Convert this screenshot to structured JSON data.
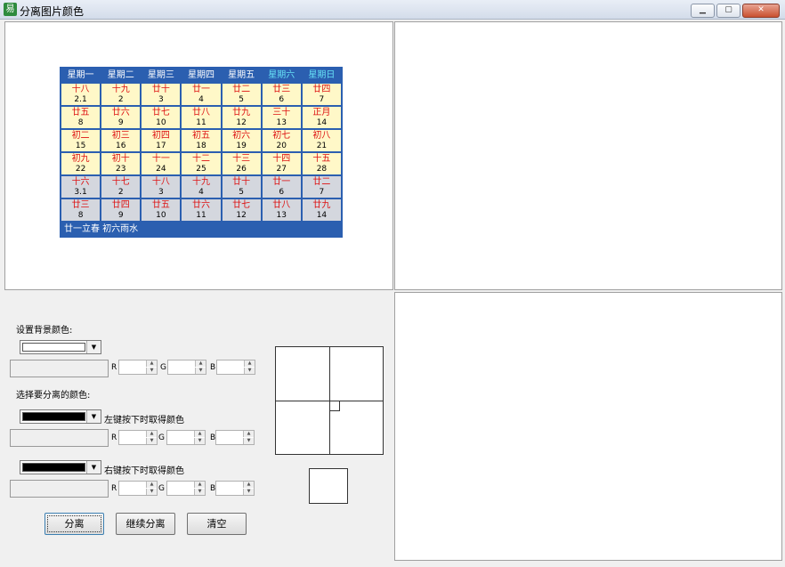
{
  "window": {
    "title": "分离图片颜色",
    "controls": [
      "minimize",
      "maximize",
      "close"
    ]
  },
  "calendar": {
    "weekdays": [
      "星期一",
      "星期二",
      "星期三",
      "星期四",
      "星期五",
      "星期六",
      "星期日"
    ],
    "rows": [
      {
        "gray": false,
        "cells": [
          [
            "十八",
            "2.1"
          ],
          [
            "十九",
            "2"
          ],
          [
            "廿十",
            "3"
          ],
          [
            "廿一",
            "4"
          ],
          [
            "廿二",
            "5"
          ],
          [
            "廿三",
            "6"
          ],
          [
            "廿四",
            "7"
          ]
        ]
      },
      {
        "gray": false,
        "cells": [
          [
            "廿五",
            "8"
          ],
          [
            "廿六",
            "9"
          ],
          [
            "廿七",
            "10"
          ],
          [
            "廿八",
            "11"
          ],
          [
            "廿九",
            "12"
          ],
          [
            "三十",
            "13"
          ],
          [
            "正月",
            "14"
          ]
        ]
      },
      {
        "gray": false,
        "cells": [
          [
            "初二",
            "15"
          ],
          [
            "初三",
            "16"
          ],
          [
            "初四",
            "17"
          ],
          [
            "初五",
            "18"
          ],
          [
            "初六",
            "19"
          ],
          [
            "初七",
            "20"
          ],
          [
            "初八",
            "21"
          ]
        ]
      },
      {
        "gray": false,
        "cells": [
          [
            "初九",
            "22"
          ],
          [
            "初十",
            "23"
          ],
          [
            "十一",
            "24"
          ],
          [
            "十二",
            "25"
          ],
          [
            "十三",
            "26"
          ],
          [
            "十四",
            "27"
          ],
          [
            "十五",
            "28"
          ]
        ]
      },
      {
        "gray": true,
        "cells": [
          [
            "十六",
            "3.1"
          ],
          [
            "十七",
            "2"
          ],
          [
            "十八",
            "3"
          ],
          [
            "十九",
            "4"
          ],
          [
            "廿十",
            "5"
          ],
          [
            "廿一",
            "6"
          ],
          [
            "廿二",
            "7"
          ]
        ]
      },
      {
        "gray": true,
        "cells": [
          [
            "廿三",
            "8"
          ],
          [
            "廿四",
            "9"
          ],
          [
            "廿五",
            "10"
          ],
          [
            "廿六",
            "11"
          ],
          [
            "廿七",
            "12"
          ],
          [
            "廿八",
            "13"
          ],
          [
            "廿九",
            "14"
          ]
        ]
      }
    ],
    "footer": "廿一立春   初六雨水"
  },
  "controls": {
    "bg_label": "设置背景颜色:",
    "sep_label": "选择要分离的颜色:",
    "left_hint": "左键按下时取得颜色",
    "right_hint": "右键按下时取得颜色",
    "r": "R",
    "g": "G",
    "b": "B",
    "bg_color": "#ffffff",
    "sep_color1": "#000000",
    "sep_color2": "#000000"
  },
  "buttons": {
    "separate": "分离",
    "continue": "继续分离",
    "clear": "清空"
  },
  "colors": {
    "accent": "#2b5fb0",
    "lunar_red": "#dd1111",
    "weekend": "#66e0f5"
  }
}
